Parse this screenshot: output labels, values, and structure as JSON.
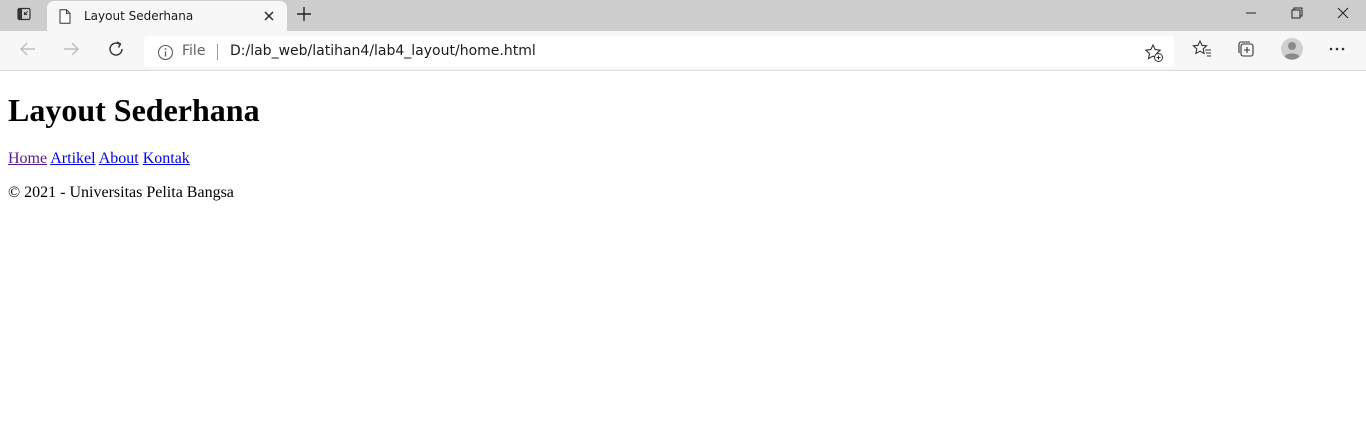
{
  "browser": {
    "tab": {
      "title": "Layout Sederhana",
      "favicon": "page-icon"
    },
    "address_bar": {
      "site_label": "File",
      "url": "D:/lab_web/latihan4/lab4_layout/home.html"
    },
    "toolbar_icons": [
      "back-icon",
      "forward-icon",
      "refresh-icon",
      "info-icon",
      "add-favorite-icon",
      "favorites-icon",
      "collections-icon",
      "profile-icon",
      "more-icon"
    ],
    "window_controls": [
      "minimize-icon",
      "restore-icon",
      "close-icon"
    ],
    "colors": {
      "tabstrip": "#cdcdcd",
      "toolbar": "#f7f7f7",
      "link": "#0000ee",
      "visited_link": "#551a8b"
    }
  },
  "page": {
    "heading": "Layout Sederhana",
    "nav": [
      {
        "label": "Home",
        "visited": true
      },
      {
        "label": "Artikel",
        "visited": false
      },
      {
        "label": "About",
        "visited": false
      },
      {
        "label": "Kontak",
        "visited": false
      }
    ],
    "footer": "© 2021 - Universitas Pelita Bangsa"
  }
}
